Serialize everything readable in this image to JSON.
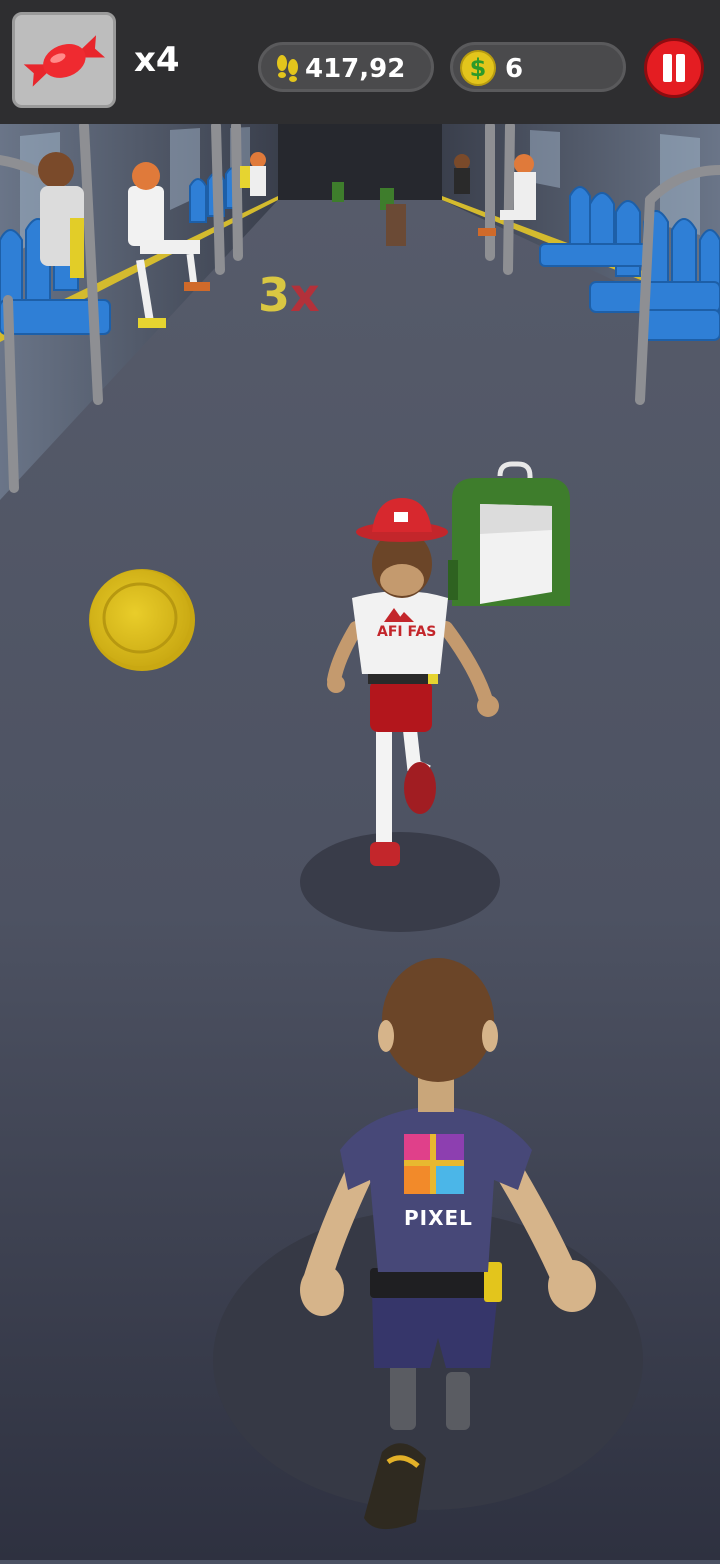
{
  "hud": {
    "powerup_icon": "candy-icon",
    "powerup_count": "x4",
    "distance_icon": "footprints-icon",
    "distance_value": "417,92",
    "coins_icon": "dollar-coin-icon",
    "coins_value": "6",
    "pause_icon": "pause-icon"
  },
  "scene": {
    "multiplier_number": "3",
    "multiplier_x": "x",
    "runner_shirt_logo": "AFI FAS",
    "player_shirt_text": "PIXEL"
  },
  "colors": {
    "hud_bg": "#2e2e30",
    "pause_red": "#e41d22",
    "coin_gold": "#e2c31e",
    "floor": "#4b5163",
    "seat_blue": "#2f7fd6",
    "backpack_green": "#3e7d2c"
  }
}
